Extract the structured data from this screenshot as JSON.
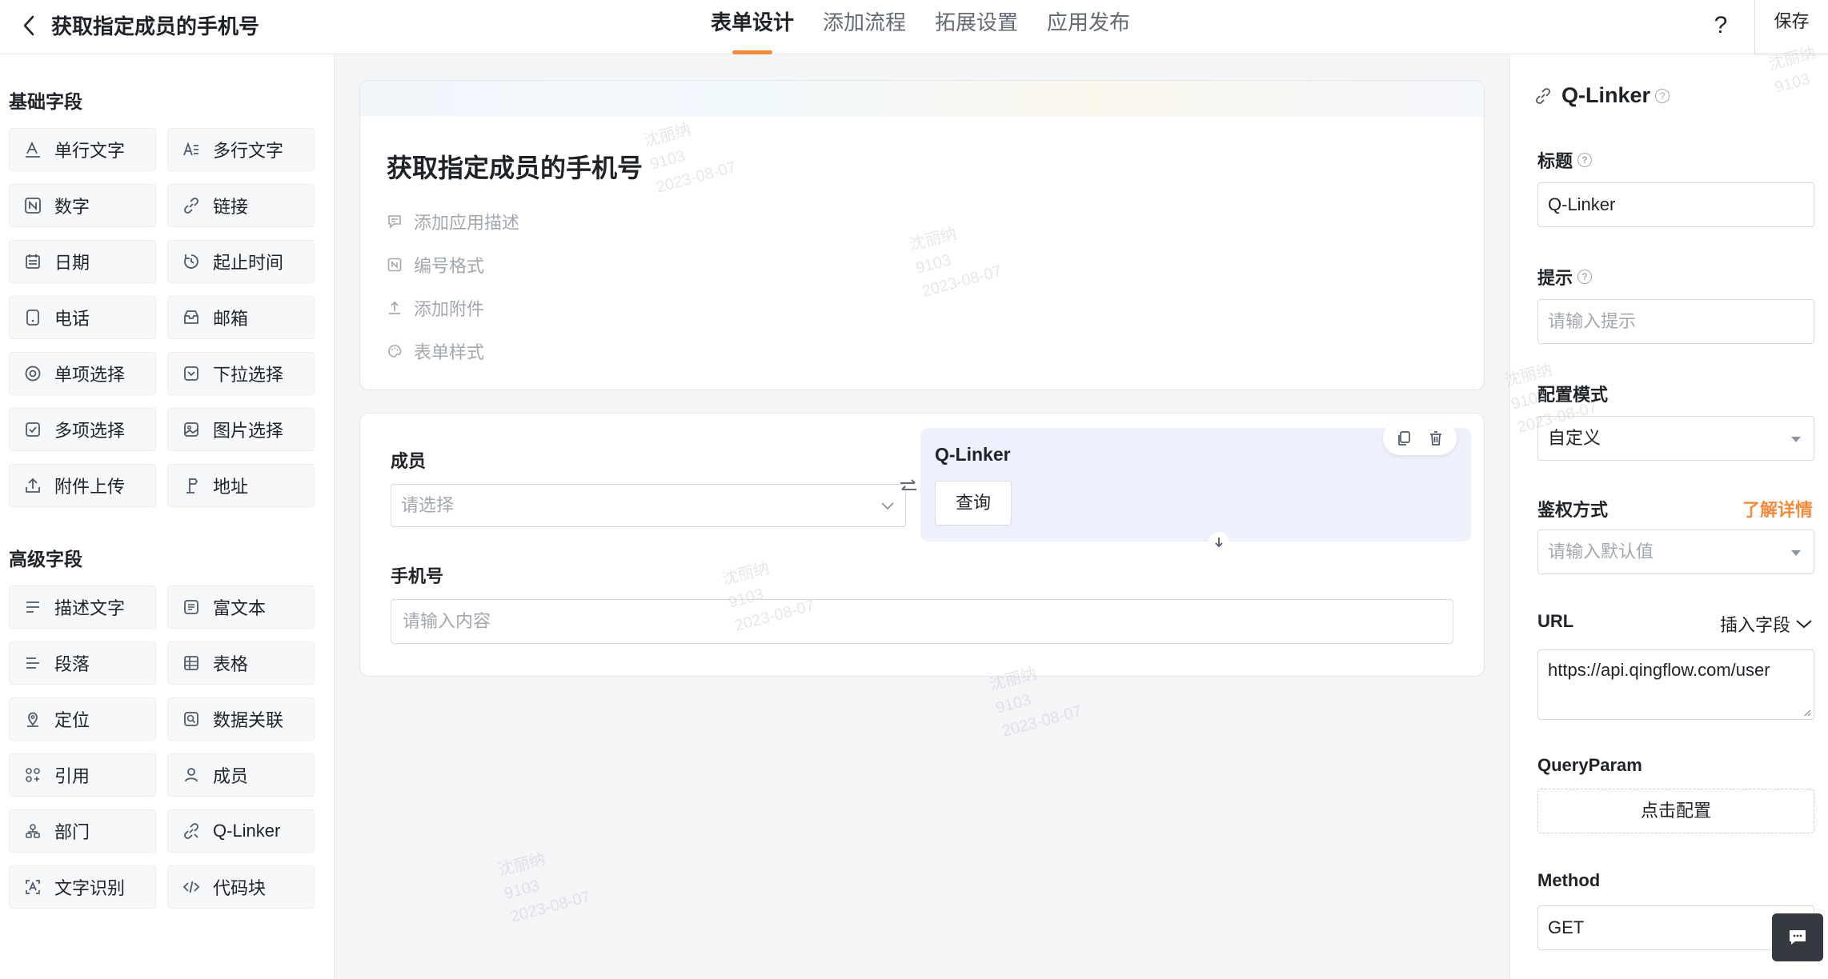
{
  "header": {
    "title": "获取指定成员的手机号",
    "tabs": [
      {
        "label": "表单设计",
        "active": true
      },
      {
        "label": "添加流程",
        "active": false
      },
      {
        "label": "拓展设置",
        "active": false
      },
      {
        "label": "应用发布",
        "active": false
      }
    ],
    "help_label": "?",
    "save_label": "保存"
  },
  "sidebar": {
    "basic_title": "基础字段",
    "basic": [
      {
        "label": "单行文字",
        "icon": "single-line-text-icon"
      },
      {
        "label": "多行文字",
        "icon": "multi-line-text-icon"
      },
      {
        "label": "数字",
        "icon": "number-icon"
      },
      {
        "label": "链接",
        "icon": "link-icon"
      },
      {
        "label": "日期",
        "icon": "calendar-icon"
      },
      {
        "label": "起止时间",
        "icon": "time-range-icon"
      },
      {
        "label": "电话",
        "icon": "phone-icon"
      },
      {
        "label": "邮箱",
        "icon": "mail-icon"
      },
      {
        "label": "单项选择",
        "icon": "radio-icon"
      },
      {
        "label": "下拉选择",
        "icon": "dropdown-icon"
      },
      {
        "label": "多项选择",
        "icon": "checkbox-icon"
      },
      {
        "label": "图片选择",
        "icon": "image-icon"
      },
      {
        "label": "附件上传",
        "icon": "upload-icon"
      },
      {
        "label": "地址",
        "icon": "address-icon"
      }
    ],
    "advanced_title": "高级字段",
    "advanced": [
      {
        "label": "描述文字",
        "icon": "description-icon"
      },
      {
        "label": "富文本",
        "icon": "rich-text-icon"
      },
      {
        "label": "段落",
        "icon": "paragraph-icon"
      },
      {
        "label": "表格",
        "icon": "table-icon"
      },
      {
        "label": "定位",
        "icon": "location-icon"
      },
      {
        "label": "数据关联",
        "icon": "data-link-icon"
      },
      {
        "label": "引用",
        "icon": "reference-icon"
      },
      {
        "label": "成员",
        "icon": "member-icon"
      },
      {
        "label": "部门",
        "icon": "department-icon"
      },
      {
        "label": "Q-Linker",
        "icon": "qlinker-icon"
      },
      {
        "label": "文字识别",
        "icon": "ocr-icon"
      },
      {
        "label": "代码块",
        "icon": "code-icon"
      }
    ]
  },
  "form": {
    "title": "获取指定成员的手机号",
    "meta": [
      {
        "label": "添加应用描述",
        "icon": "comment-icon"
      },
      {
        "label": "编号格式",
        "icon": "number-format-icon"
      },
      {
        "label": "添加附件",
        "icon": "attachment-icon"
      },
      {
        "label": "表单样式",
        "icon": "palette-icon"
      }
    ],
    "member_label": "成员",
    "member_placeholder": "请选择",
    "qlinker_title": "Q-Linker",
    "query_label": "查询",
    "phone_label": "手机号",
    "phone_placeholder": "请输入内容"
  },
  "panel": {
    "title": "Q-Linker",
    "title_label": "标题",
    "title_value": "Q-Linker",
    "hint_label": "提示",
    "hint_placeholder": "请输入提示",
    "mode_label": "配置模式",
    "mode_value": "自定义",
    "auth_label": "鉴权方式",
    "learn_more": "了解详情",
    "auth_placeholder": "请输入默认值",
    "url_label": "URL",
    "insert_field": "插入字段",
    "url_value": "https://api.qingflow.com/user",
    "queryparam_label": "QueryParam",
    "config_button": "点击配置",
    "method_label": "Method",
    "method_value": "GET"
  },
  "watermark": {
    "name": "沈丽纳",
    "id": "9103",
    "date": "2023-08-07"
  },
  "colors": {
    "accent": "#f58a3d",
    "qlinker_bg": "#eef0fb"
  }
}
